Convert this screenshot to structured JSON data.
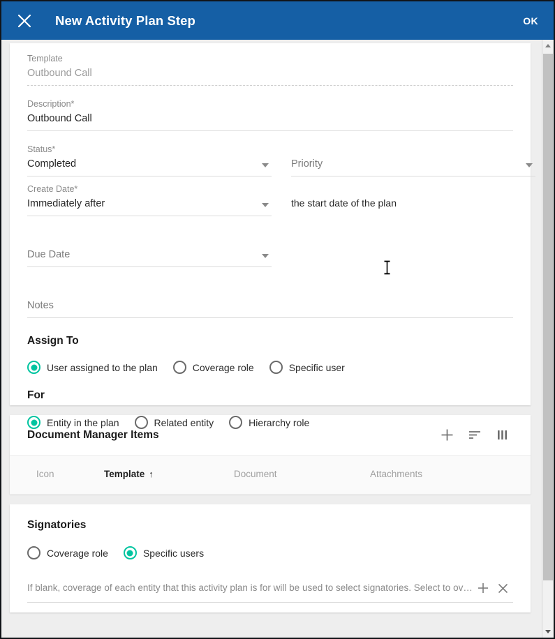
{
  "titlebar": {
    "close_icon": "close-icon",
    "title": "New Activity Plan Step",
    "ok_label": "OK"
  },
  "form": {
    "template": {
      "label": "Template",
      "value": "Outbound Call",
      "disabled": true
    },
    "description": {
      "label": "Description*",
      "value": "Outbound Call"
    },
    "status": {
      "label": "Status*",
      "value": "Completed",
      "caret_icon": "chevron-down-icon"
    },
    "priority": {
      "label": "",
      "placeholder": "Priority",
      "caret_icon": "chevron-down-icon"
    },
    "create_date": {
      "label": "Create Date*",
      "value": "Immediately after",
      "caret_icon": "chevron-down-icon"
    },
    "create_date_helper": "the start date of the plan",
    "due_date": {
      "label": "",
      "placeholder": "Due Date",
      "caret_icon": "chevron-down-icon"
    },
    "notes": {
      "label": "",
      "placeholder": "Notes"
    }
  },
  "assign_to": {
    "title": "Assign To",
    "options": [
      {
        "label": "User assigned to the plan",
        "selected": true
      },
      {
        "label": "Coverage role",
        "selected": false
      },
      {
        "label": "Specific user",
        "selected": false
      }
    ]
  },
  "for_section": {
    "title": "For",
    "options": [
      {
        "label": "Entity in the plan",
        "selected": true
      },
      {
        "label": "Related entity",
        "selected": false
      },
      {
        "label": "Hierarchy role",
        "selected": false
      }
    ]
  },
  "document_manager": {
    "title": "Document Manager Items",
    "actions": [
      {
        "name": "add-icon",
        "label": "Add"
      },
      {
        "name": "sort-icon",
        "label": "Sort"
      },
      {
        "name": "columns-icon",
        "label": "Columns"
      }
    ],
    "columns": [
      {
        "label": "Icon",
        "sorted": false,
        "sort_arrow": ""
      },
      {
        "label": "Template",
        "sorted": true,
        "sort_arrow": "↑"
      },
      {
        "label": "Document",
        "sorted": false,
        "sort_arrow": ""
      },
      {
        "label": "Attachments",
        "sorted": false,
        "sort_arrow": ""
      }
    ]
  },
  "signatories": {
    "title": "Signatories",
    "options": [
      {
        "label": "Coverage role",
        "selected": false
      },
      {
        "label": "Specific users",
        "selected": true
      }
    ],
    "input_placeholder": "If blank, coverage of each entity that this activity plan is for will be used to select signatories. Select to overr…",
    "add_icon": "plus-icon",
    "clear_icon": "close-icon"
  },
  "scrollbar": {
    "up_arrow_icon": "scroll-up-arrow-icon",
    "down_arrow_icon": "scroll-down-arrow-icon"
  },
  "colors": {
    "header_blue": "#155fa5",
    "accent_teal": "#00c4a0",
    "page_background": "#eeeeee",
    "card_background": "#ffffff"
  }
}
